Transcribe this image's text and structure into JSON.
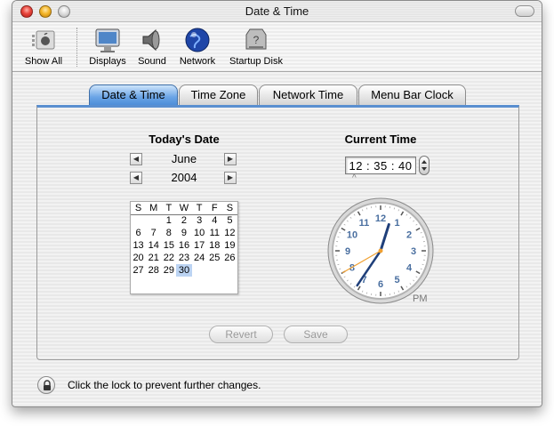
{
  "window": {
    "title": "Date & Time"
  },
  "toolbar": {
    "items": [
      {
        "label": "Show All",
        "icon": "show-all-icon"
      },
      {
        "label": "Displays",
        "icon": "displays-icon"
      },
      {
        "label": "Sound",
        "icon": "sound-icon"
      },
      {
        "label": "Network",
        "icon": "network-icon"
      },
      {
        "label": "Startup Disk",
        "icon": "startup-disk-icon"
      }
    ]
  },
  "tabs": [
    {
      "label": "Date & Time",
      "active": true
    },
    {
      "label": "Time Zone",
      "active": false
    },
    {
      "label": "Network Time",
      "active": false
    },
    {
      "label": "Menu Bar Clock",
      "active": false
    }
  ],
  "date": {
    "heading": "Today's Date",
    "month": "June",
    "year": "2004",
    "weekdays": [
      "S",
      "M",
      "T",
      "W",
      "T",
      "F",
      "S"
    ],
    "weeks": [
      [
        "",
        "",
        "1",
        "2",
        "3",
        "4",
        "5"
      ],
      [
        "6",
        "7",
        "8",
        "9",
        "10",
        "11",
        "12"
      ],
      [
        "13",
        "14",
        "15",
        "16",
        "17",
        "18",
        "19"
      ],
      [
        "20",
        "21",
        "22",
        "23",
        "24",
        "25",
        "26"
      ],
      [
        "27",
        "28",
        "29",
        "30",
        "",
        "",
        ""
      ]
    ],
    "selected_day": "30"
  },
  "time": {
    "heading": "Current Time",
    "value": "12 : 35 : 40",
    "hours": 12,
    "minutes": 35,
    "seconds": 40,
    "period": "PM",
    "dial_numbers": [
      "12",
      "1",
      "2",
      "3",
      "4",
      "5",
      "6",
      "7",
      "8",
      "9",
      "10",
      "11"
    ]
  },
  "buttons": {
    "revert": "Revert",
    "save": "Save"
  },
  "lock": {
    "text": "Click the lock to prevent further changes.",
    "icon": "lock-icon"
  },
  "colors": {
    "accent": "#5a8fd0",
    "selected_day": "#bcd4f3",
    "second_hand": "#f0a030",
    "hands": "#1f3f7a"
  }
}
